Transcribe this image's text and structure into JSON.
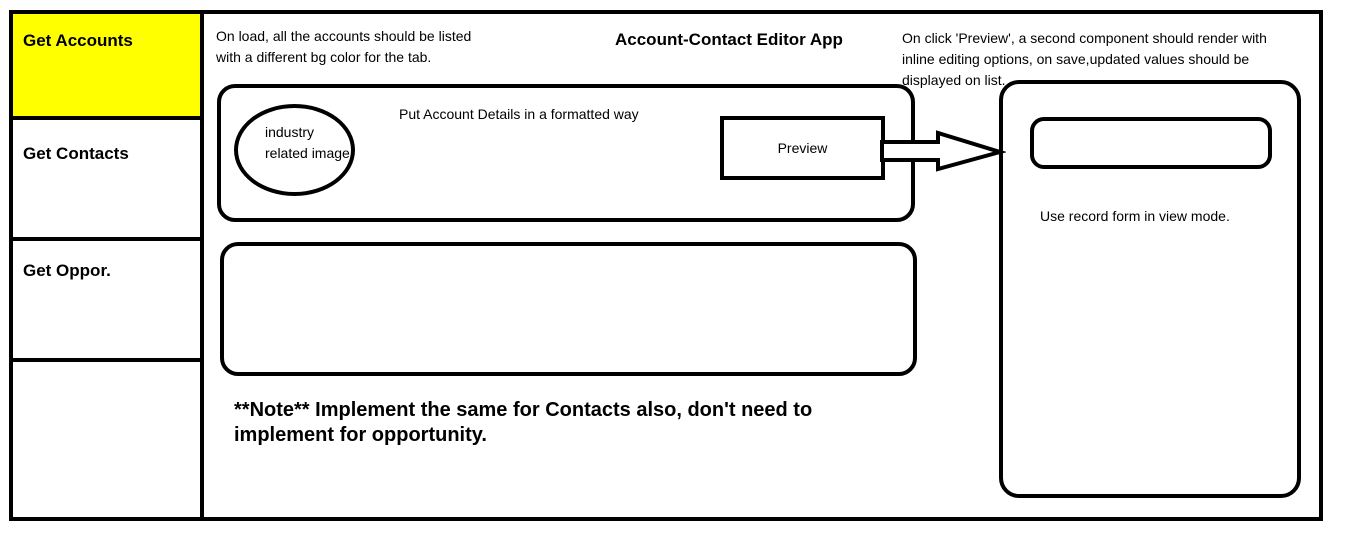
{
  "sidebar": {
    "tabs": [
      {
        "label": "Get Accounts"
      },
      {
        "label": "Get Contacts"
      },
      {
        "label": "Get Oppor."
      }
    ],
    "active_color": "#ffff00"
  },
  "header": {
    "title": "Account-Contact Editor App",
    "left_note": "On load, all the accounts should be listed with a different bg color for the tab.",
    "right_note": "On click 'Preview', a second component should render with inline editing options, on save,updated values should be displayed on list."
  },
  "account_card": {
    "image_label": "industry related image",
    "details_label": "Put Account Details in a formatted way",
    "preview_button": "Preview"
  },
  "preview_panel": {
    "caption": "Use record form in view mode."
  },
  "footer_note": "**Note** Implement the same for Contacts also, don't need to implement for opportunity."
}
